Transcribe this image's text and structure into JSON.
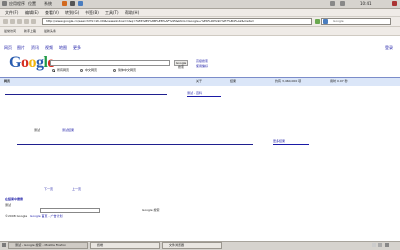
{
  "panel": {
    "items": [
      "应用程序",
      "位置",
      "系统"
    ],
    "clock": "10:41"
  },
  "menubar": {
    "items": [
      "文件(F)",
      "编辑(E)",
      "查看(V)",
      "转到(G)",
      "书签(B)",
      "工具(T)",
      "帮助(H)"
    ]
  },
  "navbar": {
    "url": "http://www.google.cn/search?hl=zh-CN&newwindow=1&q=%E6%B5%8B%E8%AF%95&btnG=Google+%E6%90%9C%E7%B4%A2&meta=",
    "search_placeholder": "Google"
  },
  "bookmarks": {
    "items": [
      "最常访问",
      "新手上路",
      "最新头条"
    ]
  },
  "page": {
    "topnav": [
      "网页",
      "图片",
      "资讯",
      "视频",
      "地图",
      "更多"
    ],
    "signin": "登录",
    "logo_letters": [
      "G",
      "o",
      "o",
      "g",
      "l",
      "e"
    ],
    "logo_sub": "中国",
    "search_button": "Google 搜索",
    "advanced_search": "高级搜索",
    "preferences": "使用偏好",
    "radio_options": [
      "所有网页",
      "中文网页",
      "简体中文网页"
    ],
    "results_bar": {
      "left": "网页",
      "middle1": "关于",
      "middle2": "结果",
      "right1": "约有 3,460,000 项",
      "right2": "用时 0.07 秒"
    },
    "result_link_1": "测试 - 百科",
    "result_text_1": "测试",
    "result_text_2": "测试结果",
    "result_link_2": "更多结果",
    "bottom_links": [
      "下一页",
      "上一页"
    ],
    "footer_link": "在结果中搜索",
    "footer_line_1": "测试",
    "footer_line_2": "Google 搜索",
    "footer_line_3": "©2008 Google",
    "footer_line_4": "Google 首页 - 广告计划"
  },
  "taskbar": {
    "items": [
      "测试 - Google 搜索 - Mozilla Firefox",
      "终端",
      "文件浏览器"
    ]
  }
}
